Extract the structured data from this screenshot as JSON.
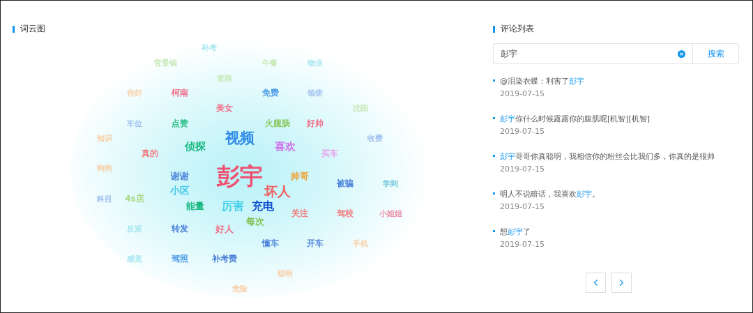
{
  "cloud_panel": {
    "title": "词云图",
    "words": [
      {
        "text": "补考",
        "color": "#a8e6f0"
      },
      {
        "text": "背景锅",
        "color": "#c8e8b8"
      },
      {
        "text": "午餐",
        "color": "#c8e8b8"
      },
      {
        "text": "物业",
        "color": "#a8e6f0"
      },
      {
        "text": "套路",
        "color": "#c8e8b8"
      },
      {
        "text": "你好",
        "color": "#f8d0a8"
      },
      {
        "text": "柯南",
        "color": "#f0708a"
      },
      {
        "text": "免费",
        "color": "#4a9ae8"
      },
      {
        "text": "馅饼",
        "color": "#a0c0f0"
      },
      {
        "text": "美女",
        "color": "#f0708a"
      },
      {
        "text": "沈阳",
        "color": "#c8e8b8"
      },
      {
        "text": "车位",
        "color": "#a0c0f0"
      },
      {
        "text": "点赞",
        "color": "#30c08a"
      },
      {
        "text": "火腿肠",
        "color": "#88c860"
      },
      {
        "text": "好帅",
        "color": "#f0708a"
      },
      {
        "text": "知识",
        "color": "#f8d0a8"
      },
      {
        "text": "视频",
        "color": "#2d8ae8"
      },
      {
        "text": "收费",
        "color": "#a0c0f0"
      },
      {
        "text": "真的",
        "color": "#f08080"
      },
      {
        "text": "侦探",
        "color": "#18b880"
      },
      {
        "text": "喜欢",
        "color": "#d070e8"
      },
      {
        "text": "买车",
        "color": "#e8a0e8"
      },
      {
        "text": "狗狗",
        "color": "#f8d0a8"
      },
      {
        "text": "谢谢",
        "color": "#4a80d8"
      },
      {
        "text": "彭宇",
        "color": "#f05070"
      },
      {
        "text": "帅哥",
        "color": "#f0a030"
      },
      {
        "text": "被骗",
        "color": "#4a80d8"
      },
      {
        "text": "学到",
        "color": "#70c8dc"
      },
      {
        "text": "小区",
        "color": "#40c8e8"
      },
      {
        "text": "坏人",
        "color": "#f06060"
      },
      {
        "text": "科目",
        "color": "#a0c0f0"
      },
      {
        "text": "4s店",
        "color": "#a8d880"
      },
      {
        "text": "能量",
        "color": "#18b880"
      },
      {
        "text": "厉害",
        "color": "#40d0e8"
      },
      {
        "text": "充电",
        "color": "#1050d0"
      },
      {
        "text": "关注",
        "color": "#f08080"
      },
      {
        "text": "驾校",
        "color": "#f08080"
      },
      {
        "text": "小姐姐",
        "color": "#e890a8"
      },
      {
        "text": "每次",
        "color": "#80c050"
      },
      {
        "text": "反派",
        "color": "#a8e6f0"
      },
      {
        "text": "转发",
        "color": "#4a80d8"
      },
      {
        "text": "好人",
        "color": "#f0708a"
      },
      {
        "text": "懂车",
        "color": "#4a80d8"
      },
      {
        "text": "开车",
        "color": "#4a80d8"
      },
      {
        "text": "手机",
        "color": "#f8d0a8"
      },
      {
        "text": "感觉",
        "color": "#a8e6f0"
      },
      {
        "text": "驾照",
        "color": "#4a9ae8"
      },
      {
        "text": "补考费",
        "color": "#4a80d8"
      },
      {
        "text": "聪明",
        "color": "#f8d0a8"
      },
      {
        "text": "危险",
        "color": "#f8d0a8"
      }
    ]
  },
  "comment_panel": {
    "title": "评论列表",
    "search": {
      "value": "彭宇",
      "button": "搜索"
    },
    "comments": [
      {
        "parts": [
          {
            "text": "@泪染衣蝶：利害了",
            "highlight": false
          },
          {
            "text": "彭宇",
            "highlight": true
          }
        ],
        "date": "2019-07-15"
      },
      {
        "parts": [
          {
            "text": "彭宇",
            "highlight": true
          },
          {
            "text": "你什么时候露露你的腹肌呢[机智][机智]",
            "highlight": false
          }
        ],
        "date": "2019-07-15"
      },
      {
        "parts": [
          {
            "text": "彭宇",
            "highlight": true
          },
          {
            "text": "哥哥你真聪明，我相信你的粉丝会比我们多，你真的是很帅",
            "highlight": false
          }
        ],
        "date": "2019-07-15"
      },
      {
        "parts": [
          {
            "text": "明人不说暗话，我喜欢",
            "highlight": false
          },
          {
            "text": "彭宇",
            "highlight": true
          },
          {
            "text": "。",
            "highlight": false
          }
        ],
        "date": "2019-07-15"
      },
      {
        "parts": [
          {
            "text": "想",
            "highlight": false
          },
          {
            "text": "彭宇",
            "highlight": true
          },
          {
            "text": "了",
            "highlight": false
          }
        ],
        "date": "2019-07-15"
      }
    ]
  }
}
